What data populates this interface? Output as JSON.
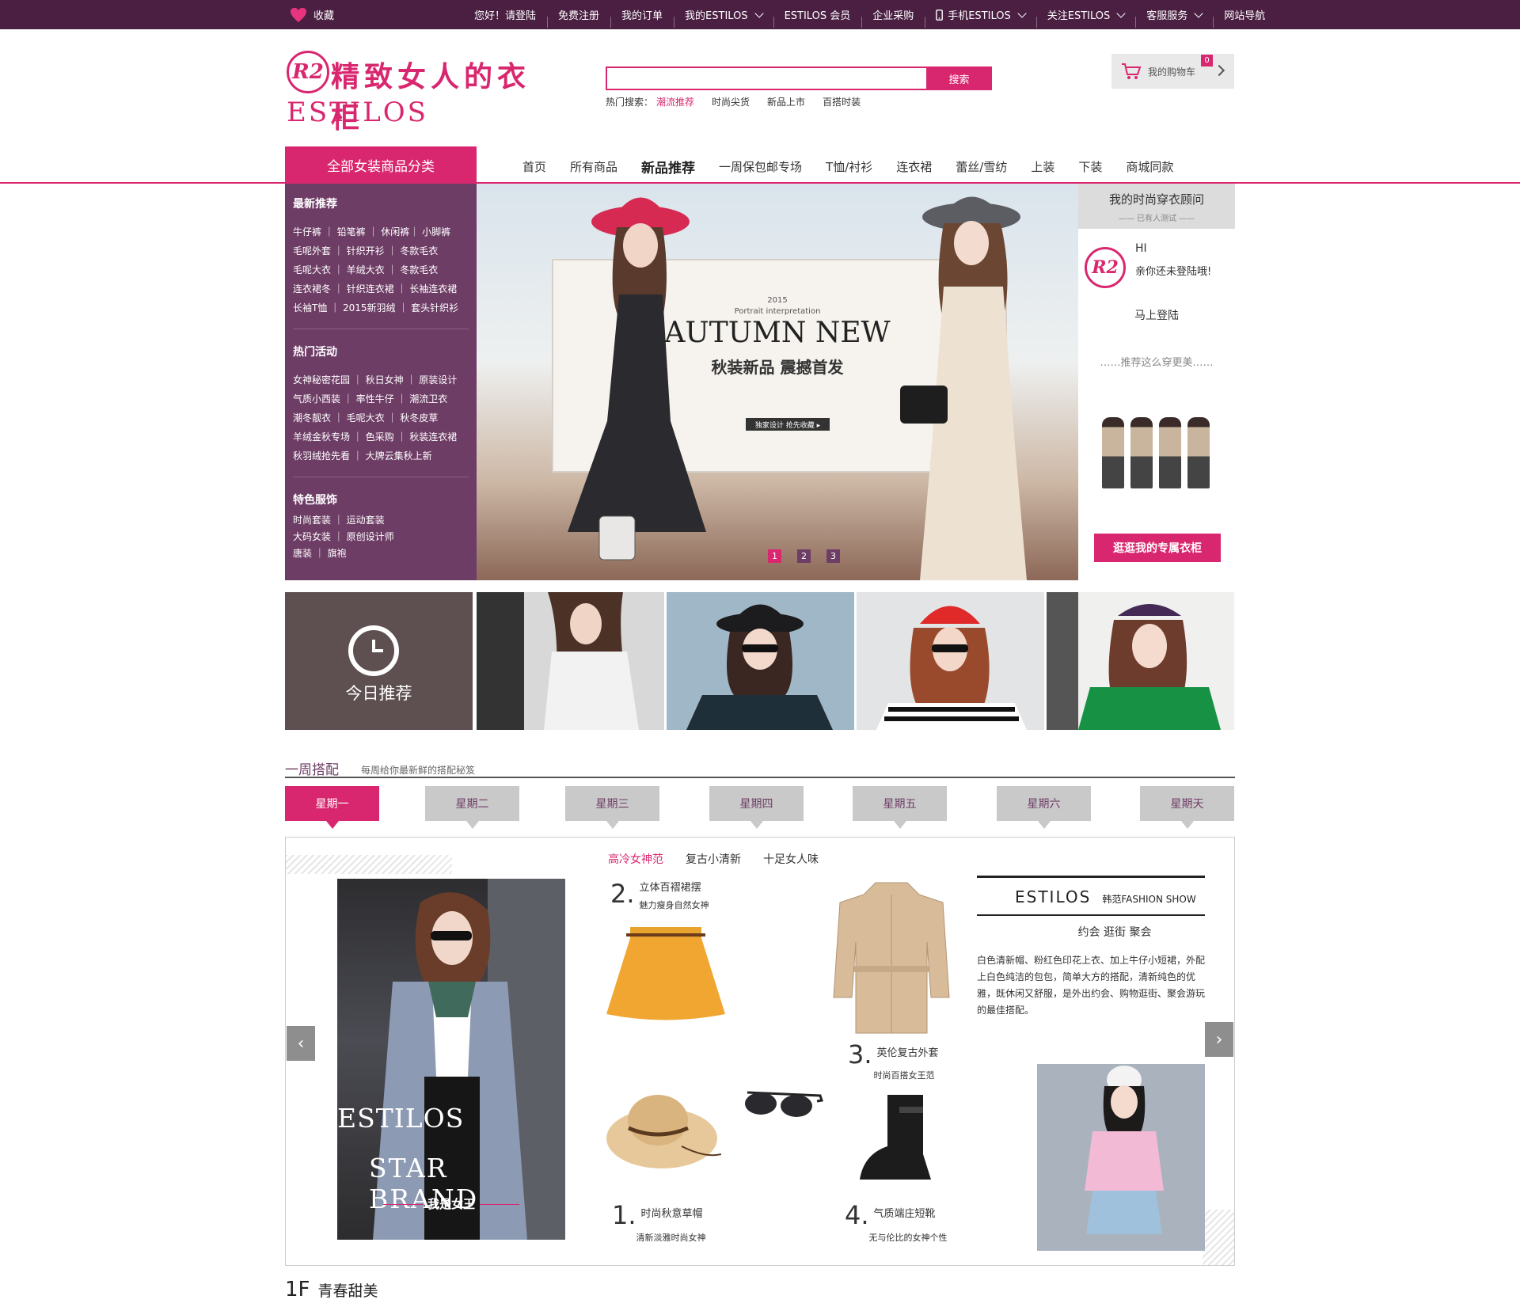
{
  "colors": {
    "accent": "#d9276f",
    "topbar": "#4a1f42",
    "sidebar": "#6e3d66",
    "tab_inactive": "#c9c9c9"
  },
  "topbar": {
    "favorite": "收藏",
    "links": [
      {
        "label": "您好！请登陆",
        "dropdown": false
      },
      {
        "label": "免费注册",
        "dropdown": false
      },
      {
        "label": "我的订单",
        "dropdown": false
      },
      {
        "label": "我的ESTILOS",
        "dropdown": true
      },
      {
        "label": "ESTILOS 会员",
        "dropdown": false
      },
      {
        "label": "企业采购",
        "dropdown": false
      },
      {
        "label": "手机ESTILOS",
        "dropdown": true
      },
      {
        "label": "关注ESTILOS",
        "dropdown": true
      },
      {
        "label": "客服服务",
        "dropdown": true
      },
      {
        "label": "网站导航",
        "dropdown": false
      }
    ]
  },
  "logo": {
    "badge": "R2",
    "slogan": "精致女人的衣柜",
    "brand": "ESTILOS"
  },
  "search": {
    "value": "",
    "button": "搜索",
    "hot_label": "热门搜索：",
    "hot_words": [
      "潮流推荐",
      "时尚尖货",
      "新品上市",
      "百搭时装"
    ]
  },
  "cart": {
    "label": "我的购物车",
    "count": "0"
  },
  "nav": {
    "category_title": "全部女装商品分类",
    "items": [
      "首页",
      "所有商品",
      "新品推荐",
      "一周保包邮专场",
      "T恤/衬衫",
      "连衣裙",
      "蕾丝/雪纺",
      "上装",
      "下装",
      "商城同款"
    ],
    "current_index": 2
  },
  "sidebar": {
    "sections": [
      {
        "title": "最新推荐",
        "rows": [
          "牛仔裤 ｜ 铅笔裤 ｜ 休闲裤｜ 小脚裤",
          "毛呢外套 ｜ 针织开衫 ｜ 冬款毛衣",
          "毛呢大衣 ｜ 羊绒大衣 ｜ 冬款毛衣",
          "连衣裙冬 ｜ 针织连衣裙 ｜ 长袖连衣裙",
          "长袖T恤 ｜ 2015新羽绒 ｜ 套头针织衫"
        ]
      },
      {
        "title": "热门活动",
        "rows": [
          "女神秘密花园 ｜ 秋日女神 ｜ 原装设计",
          "气质小西装 ｜ 率性牛仔 ｜ 潮流卫衣",
          "潮冬靓衣 ｜ 毛呢大衣 ｜ 秋冬皮草",
          "羊绒金秋专场 ｜ 色采购 ｜ 秋装连衣裙",
          "秋羽绒抢先看 ｜ 大牌云集秋上新"
        ]
      },
      {
        "title": "特色服饰",
        "rows": [
          "时尚套装 ｜ 运动套装",
          "大码女装 ｜ 原创设计师",
          "唐装 ｜ 旗袍"
        ]
      }
    ]
  },
  "banner": {
    "year": "2015",
    "caption": "Portrait interpretation",
    "headline": "AUTUMN NEW",
    "subheadline": "秋装新品 震撼首发",
    "cta": "独家设计 抢先收藏 ▸",
    "pages": [
      "1",
      "2",
      "3"
    ],
    "current_page": 0
  },
  "advisor": {
    "title": "我的时尚穿衣顾问",
    "subtitle": "—— 已有人测试 ——",
    "logo": "R2",
    "greeting": "HI",
    "hint": "亲你还未登陆哦!",
    "login": "马上登陆",
    "recommend": "……推荐这么穿更美……",
    "cta": "逛逛我的专属衣柜"
  },
  "today": {
    "label": "今日推荐"
  },
  "weekly": {
    "title": "一周搭配",
    "subtitle": "每周给你最新鲜的搭配秘笈",
    "days": [
      "星期一",
      "星期二",
      "星期三",
      "星期四",
      "星期五",
      "星期六",
      "星期天"
    ],
    "active_day": 0,
    "subtabs": [
      "高冷女神范",
      "复古小清新",
      "十足女人味"
    ],
    "active_subtab": 0,
    "hero": {
      "line1": "ESTILOS",
      "line2": "STAR BRAND",
      "line3": "我是女王"
    },
    "items": [
      {
        "num": "1.",
        "title": "时尚秋意草帽",
        "sub": "清新淡雅时尚女神"
      },
      {
        "num": "2.",
        "title": "立体百褶裙摆",
        "sub": "魅力瘦身自然女神"
      },
      {
        "num": "3.",
        "title": "英伦复古外套",
        "sub": "时尚百搭女王范"
      },
      {
        "num": "4.",
        "title": "气质端庄短靴",
        "sub": "无与伦比的女神个性"
      }
    ],
    "info": {
      "brand": "ESTILOS",
      "tag": "韩范FASHION SHOW",
      "occasions": "约会 逛街 聚会",
      "desc": "白色清新帽、粉红色印花上衣、加上牛仔小短裙，外配上白色纯洁的包包，简单大方的搭配，清新纯色的优雅，既休闲又舒服，是外出约会、购物逛街、聚会游玩的最佳搭配。"
    }
  },
  "floor": {
    "num": "1F",
    "title": "青春甜美"
  }
}
